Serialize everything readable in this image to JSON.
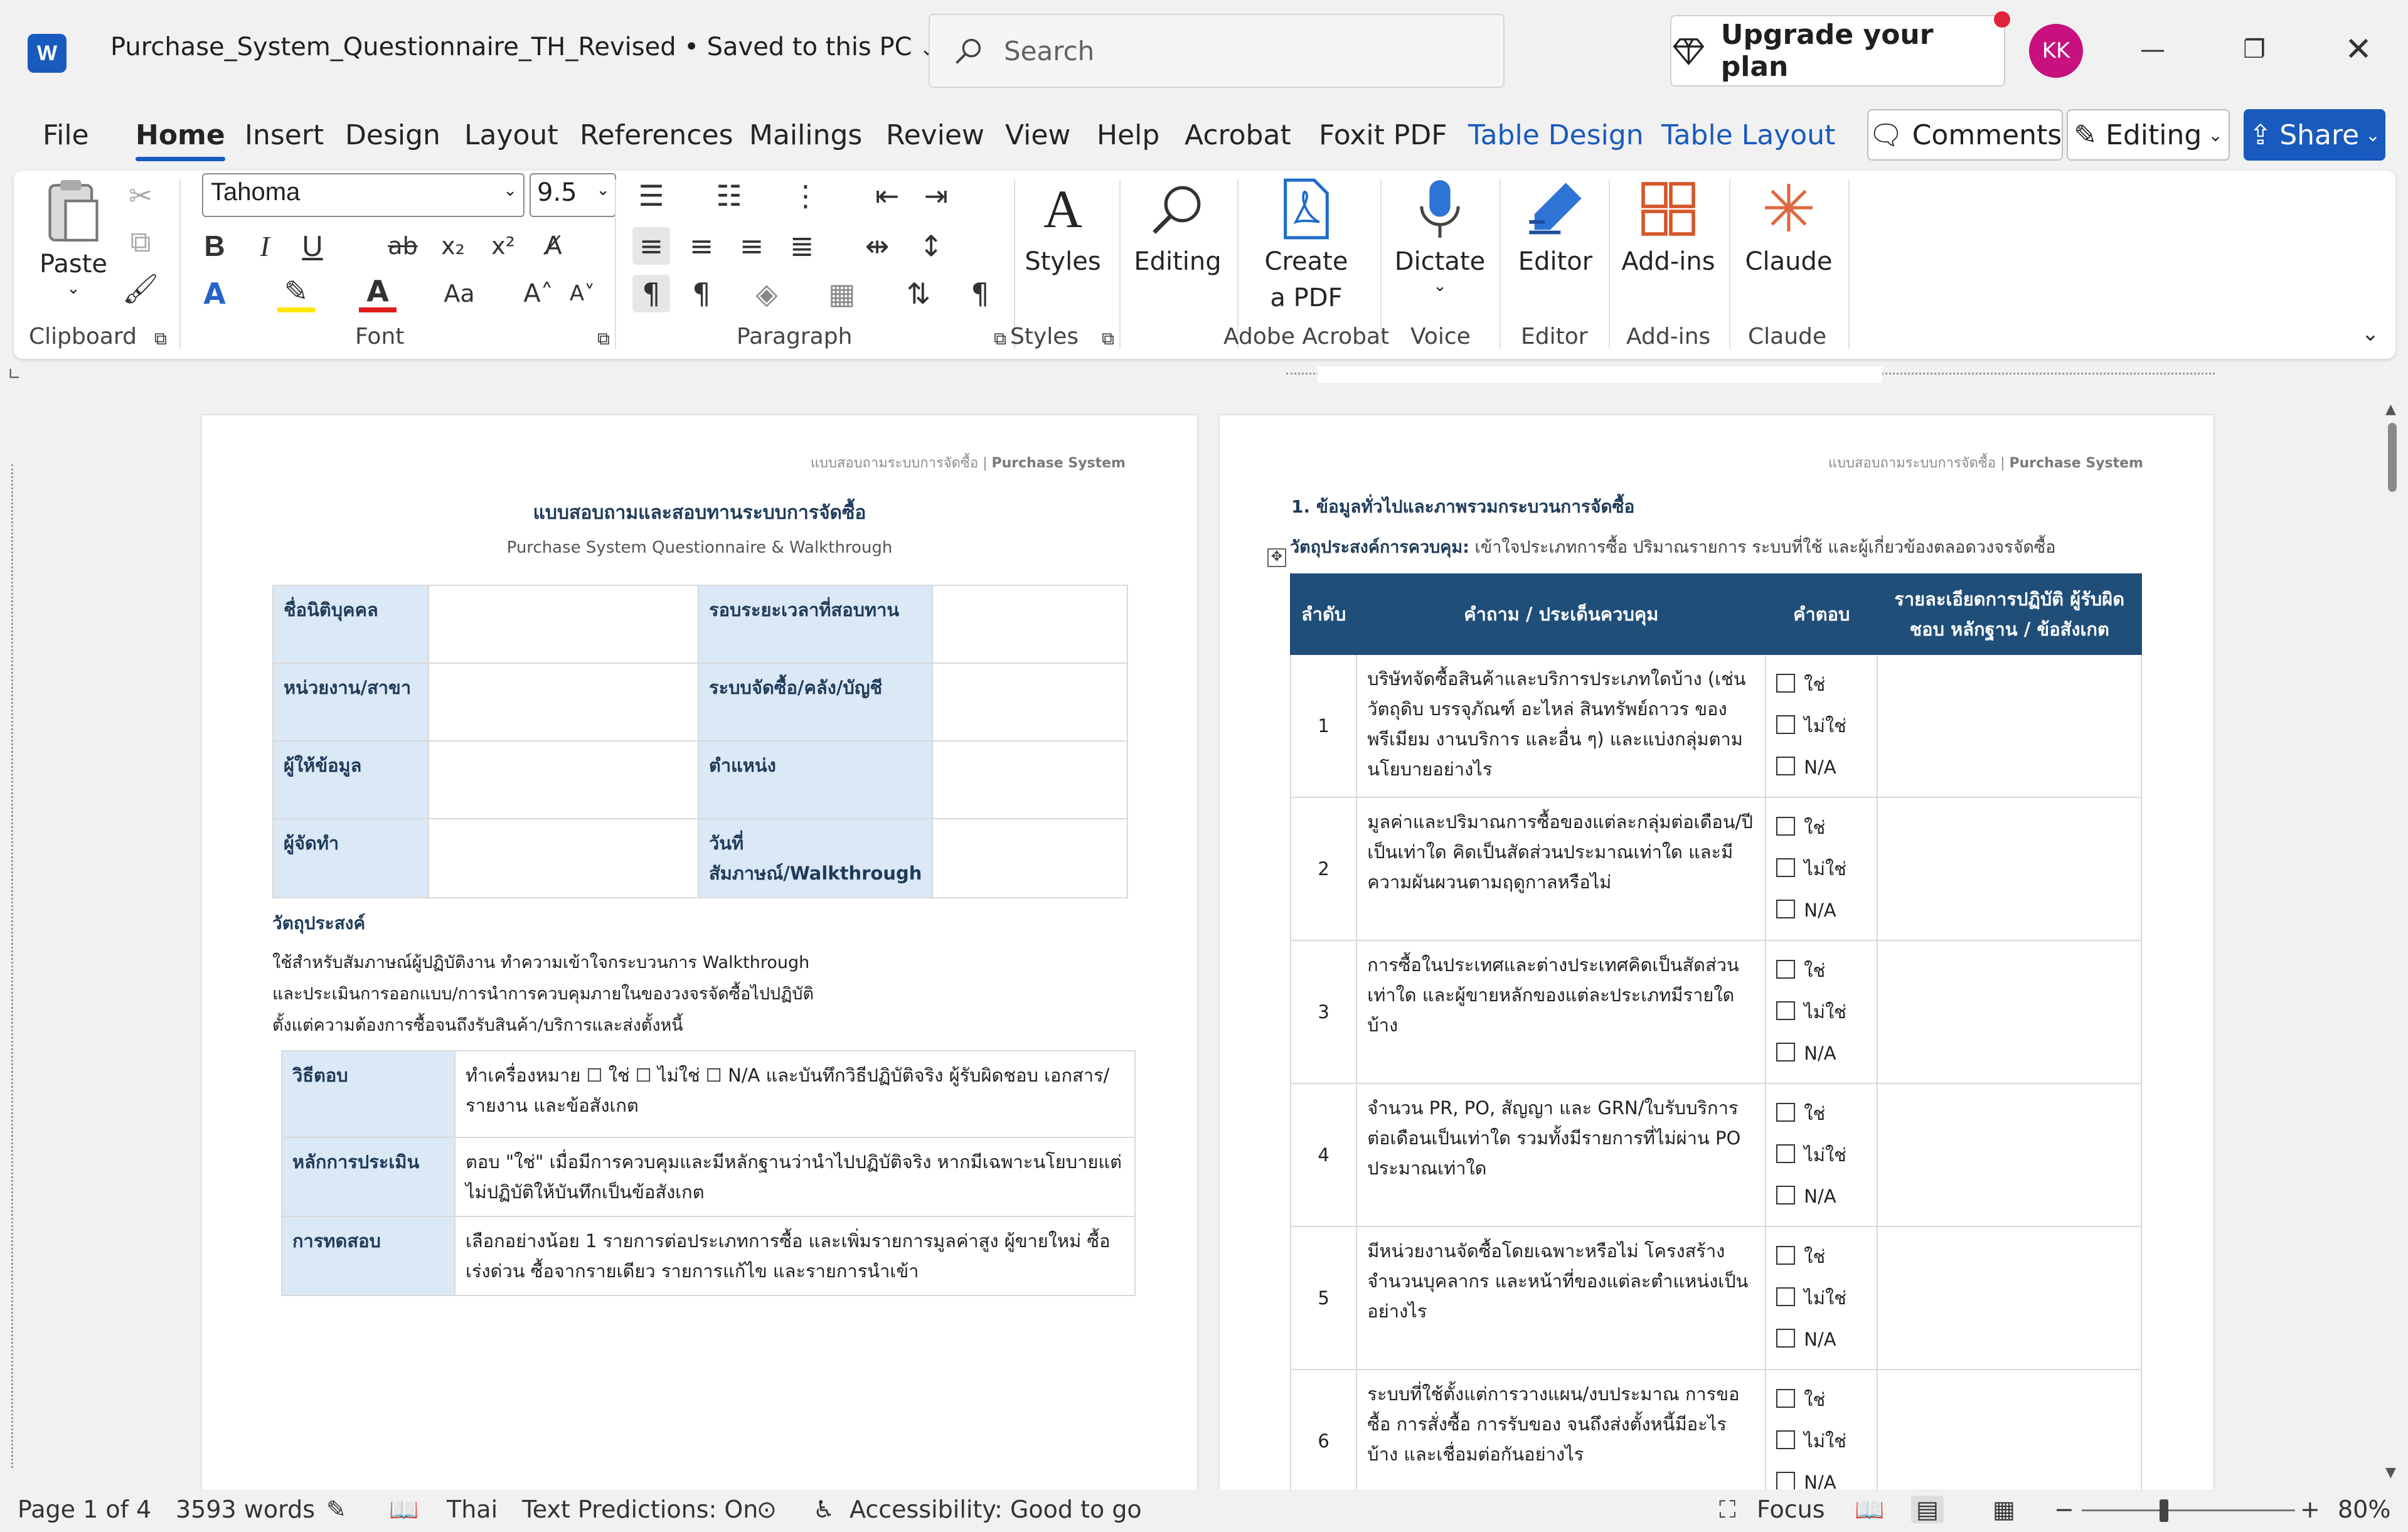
{
  "window": {
    "app_icon": "W",
    "doc_title": "Purchase_System_Questionnaire_TH_Revised • Saved to this PC",
    "search_placeholder": "Search",
    "upgrade_label": "Upgrade your plan",
    "avatar_initials": "KK"
  },
  "menu": {
    "items": [
      "File",
      "Home",
      "Insert",
      "Design",
      "Layout",
      "References",
      "Mailings",
      "Review",
      "View",
      "Help",
      "Acrobat",
      "Foxit PDF",
      "Table Design",
      "Table Layout"
    ],
    "comments_label": "Comments",
    "editing_label": "Editing",
    "share_label": "Share"
  },
  "ribbon": {
    "paste_label": "Paste",
    "clipboard_label": "Clipboard",
    "font_name": "Tahoma",
    "font_size": "9.5",
    "font_label": "Font",
    "paragraph_label": "Paragraph",
    "styles_btn": "Styles",
    "styles_label": "Styles",
    "editing_btn": "Editing",
    "create_pdf_1": "Create",
    "create_pdf_2": "a PDF",
    "acrobat_label": "Adobe Acrobat",
    "dictate_btn": "Dictate",
    "voice_label": "Voice",
    "editor_btn": "Editor",
    "editor_label": "Editor",
    "addins_btn": "Add-ins",
    "addins_label": "Add-ins",
    "claude_btn": "Claude",
    "claude_label": "Claude"
  },
  "page1": {
    "header_th": "แบบสอบถามระบบการจัดซื้อ",
    "header_en": "Purchase System",
    "title_th": "แบบสอบถามและสอบทานระบบการจัดซื้อ",
    "title_en": "Purchase System Questionnaire & Walkthrough",
    "info": [
      {
        "l1": "ชื่อนิติบุคคล",
        "l2": "รอบระยะเวลาที่สอบทาน"
      },
      {
        "l1": "หน่วยงาน/สาขา",
        "l2": "ระบบจัดซื้อ/คลัง/บัญชี"
      },
      {
        "l1": "ผู้ให้ข้อมูล",
        "l2": "ตำแหน่ง"
      },
      {
        "l1": "ผู้จัดทำ",
        "l2": "วันที่สัมภาษณ์/Walkthrough"
      }
    ],
    "objective_heading": "วัตถุประสงค์",
    "objective_text": [
      "ใช้สำหรับสัมภาษณ์ผู้ปฏิบัติงาน ทำความเข้าใจกระบวนการ Walkthrough",
      "และประเมินการออกแบบ/การนำการควบคุมภายในของวงจรจัดซื้อไปปฏิบัติ",
      "ตั้งแต่ความต้องการซื้อจนถึงรับสินค้า/บริการและส่งตั้งหนี้"
    ],
    "method": [
      {
        "label": "วิธีตอบ",
        "text": "ทำเครื่องหมาย ☐ ใช่ ☐ ไม่ใช่ ☐ N/A และบันทึกวิธีปฏิบัติจริง ผู้รับผิดชอบ เอกสาร/รายงาน และข้อสังเกต"
      },
      {
        "label": "หลักการประเมิน",
        "text": "ตอบ \"ใช่\" เมื่อมีการควบคุมและมีหลักฐานว่านำไปปฏิบัติจริง หากมีเฉพาะนโยบายแต่ไม่ปฏิบัติให้บันทึกเป็นข้อสังเกต"
      },
      {
        "label": "การทดสอบ",
        "text": "เลือกอย่างน้อย 1 รายการต่อประเภทการซื้อ และเพิ่มรายการมูลค่าสูง ผู้ขายใหม่ ซื้อเร่งด่วน ซื้อจากรายเดียว รายการแก้ไข และรายการนำเข้า"
      }
    ]
  },
  "page2": {
    "section_title": "1. ข้อมูลทั่วไปและภาพรวมกระบวนการจัดซื้อ",
    "control_obj_label": "วัตถุประสงค์การควบคุม:",
    "control_obj_text": "เข้าใจประเภทการซื้อ ปริมาณรายการ ระบบที่ใช้ และผู้เกี่ยวข้องตลอดวงจรจัดซื้อ",
    "columns": [
      "ลำดับ",
      "คำถาม / ประเด็นควบคุม",
      "คำตอบ",
      "รายละเอียดการปฏิบัติ ผู้รับผิดชอบ หลักฐาน / ข้อสังเกต"
    ],
    "answer_options": [
      "ใช่",
      "ไม่ใช่",
      "N/A"
    ],
    "rows": [
      {
        "no": "1",
        "q": "บริษัทจัดซื้อสินค้าและบริการประเภทใดบ้าง (เช่น วัตถุดิบ บรรจุภัณฑ์ อะไหล่ สินทรัพย์ถาวร ของพรีเมียม งานบริการ และอื่น ๆ) และแบ่งกลุ่มตามนโยบายอย่างไร"
      },
      {
        "no": "2",
        "q": "มูลค่าและปริมาณการซื้อของแต่ละกลุ่มต่อเดือน/ปีเป็นเท่าใด คิดเป็นสัดส่วนประมาณเท่าใด และมีความผันผวนตามฤดูกาลหรือไม่"
      },
      {
        "no": "3",
        "q": "การซื้อในประเทศและต่างประเทศคิดเป็นสัดส่วนเท่าใด และผู้ขายหลักของแต่ละประเภทมีรายใดบ้าง"
      },
      {
        "no": "4",
        "q": "จำนวน PR, PO, สัญญา และ GRN/ใบรับบริการต่อเดือนเป็นเท่าใด รวมทั้งมีรายการที่ไม่ผ่าน PO ประมาณเท่าใด"
      },
      {
        "no": "5",
        "q": "มีหน่วยงานจัดซื้อโดยเฉพาะหรือไม่ โครงสร้าง จำนวนบุคลากร และหน้าที่ของแต่ละตำแหน่งเป็นอย่างไร"
      },
      {
        "no": "6",
        "q": "ระบบที่ใช้ตั้งแต่การวางแผน/งบประมาณ การขอซื้อ การสั่งซื้อ การรับของ จนถึงส่งตั้งหนี้มีอะไรบ้าง และเชื่อมต่อกันอย่างไร"
      }
    ]
  },
  "status": {
    "page": "Page 1 of 4",
    "words": "3593 words",
    "language": "Thai",
    "predictions": "Text Predictions: On",
    "accessibility": "Accessibility: Good to go",
    "focus": "Focus",
    "zoom": "80%"
  },
  "colors": {
    "accent": "#185abd",
    "table_header": "#1f4e79",
    "label_fill": "#dbe8f5",
    "ruler_ticks": "#888888"
  }
}
